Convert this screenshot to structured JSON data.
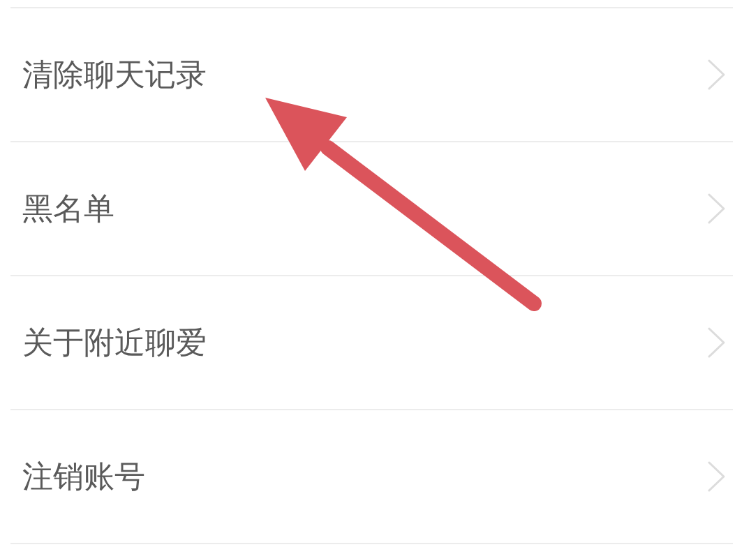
{
  "menu_items": [
    {
      "label": "清除聊天记录"
    },
    {
      "label": "黑名单"
    },
    {
      "label": "关于附近聊爱"
    },
    {
      "label": "注销账号"
    }
  ]
}
